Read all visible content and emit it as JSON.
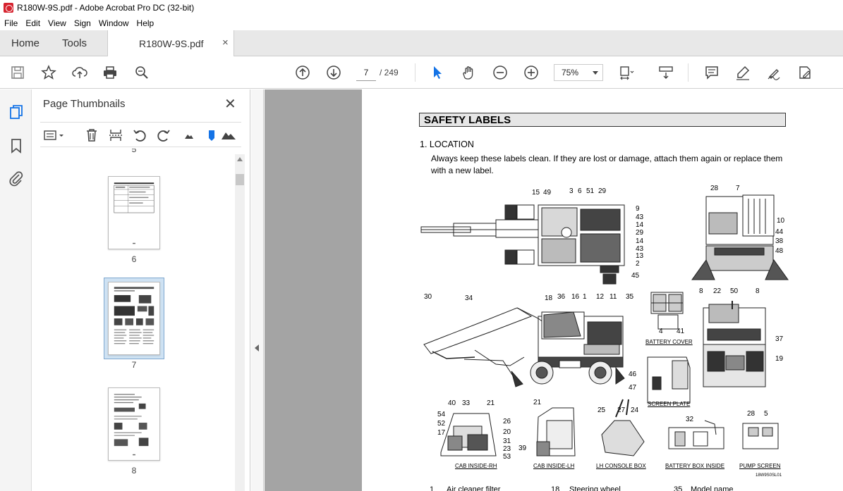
{
  "window": {
    "title": "R180W-9S.pdf - Adobe Acrobat Pro DC (32-bit)"
  },
  "menu": [
    "File",
    "Edit",
    "View",
    "Sign",
    "Window",
    "Help"
  ],
  "tabs": {
    "home": "Home",
    "tools": "Tools",
    "document": "R180W-9S.pdf"
  },
  "toolbar": {
    "page_current": "7",
    "page_total": "/ 249",
    "zoom": "75%"
  },
  "panel": {
    "title": "Page Thumbnails",
    "thumbnails": [
      {
        "label": "6"
      },
      {
        "label": "7"
      },
      {
        "label": "8"
      }
    ],
    "partial_label": "5"
  },
  "document": {
    "section_title": "SAFETY LABELS",
    "location_heading": "1.  LOCATION",
    "location_text": "Always keep these labels clean.  If they are lost or damage, attach them again or replace them with a new label.",
    "captions": {
      "battery_cover": "BATTERY COVER",
      "screen_plate": "SCREEN PLATE",
      "cab_inside_rh": "CAB INSIDE-RH",
      "cab_inside_lh": "CAB INSIDE-LH",
      "lh_console_box": "LH CONSOLE BOX",
      "battery_box_inside": "BATTERY BOX INSIDE",
      "pump_screen": "PUMP SCREEN"
    },
    "figure_id": "18W9S0SL01",
    "top_view_callouts_top": [
      "15",
      "49",
      "3",
      "6",
      "51",
      "29"
    ],
    "top_view_callouts_right": [
      "9",
      "43",
      "14",
      "29",
      "14",
      "43",
      "13",
      "2",
      "45"
    ],
    "rear_view_callouts": [
      "28",
      "7",
      "10",
      "44",
      "38",
      "48"
    ],
    "side_view_callouts": [
      "30",
      "34",
      "18",
      "36",
      "16",
      "1",
      "12",
      "11",
      "35"
    ],
    "battery_callouts": [
      "4",
      "41"
    ],
    "rear2_callouts": [
      "8",
      "22",
      "50",
      "8",
      "37",
      "19"
    ],
    "screen_callouts": [
      "46",
      "47"
    ],
    "cab_rh_callouts": [
      "40",
      "33",
      "21",
      "54",
      "52",
      "17",
      "26",
      "20",
      "31",
      "23",
      "53"
    ],
    "cab_lh_callouts": [
      "21",
      "39"
    ],
    "console_callouts": [
      "25",
      "27",
      "24"
    ],
    "battery_box_callouts": [
      "32"
    ],
    "pump_callouts": [
      "28",
      "5"
    ],
    "bottom_list": [
      {
        "num": "1",
        "text": "Air cleaner filter"
      },
      {
        "num": "18",
        "text": "Steering wheel"
      },
      {
        "num": "35",
        "text": "Model name"
      }
    ]
  }
}
